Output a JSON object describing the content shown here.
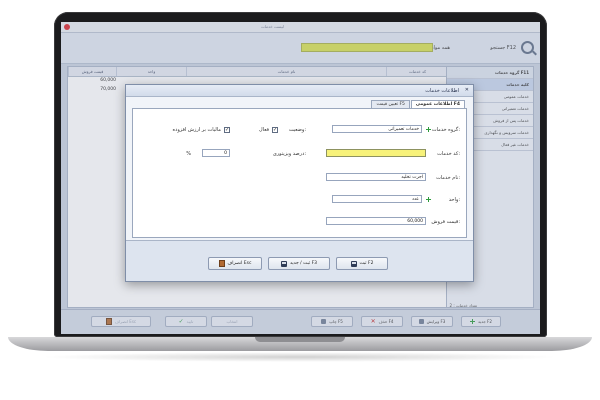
{
  "app": {
    "title": "لیست خدمات"
  },
  "toolbar": {
    "search_label": "جستجو F12",
    "field_label": "همه موارد"
  },
  "grid": {
    "columns": [
      "کد خدمات",
      "نام خدمات",
      "واحد",
      "قیمت فروش"
    ],
    "rows": [
      {
        "price": "60,000"
      },
      {
        "price": "70,000"
      }
    ],
    "footer": "تعداد خدمات : 2"
  },
  "categories": {
    "header": "گروه خدمات F11",
    "items": [
      "کلیه خدمات",
      "خدمات عمومی",
      "خدمات تعمیراتی",
      "خدمات پس از فروش",
      "خدمات سرویس و نگهداری",
      "خدمات غیر فعال"
    ]
  },
  "bottombar": {
    "new": "جدید F2",
    "edit": "ویرایش F3",
    "delete": "حذف F4",
    "print": "چاپ F5",
    "select": "انتخاب",
    "confirm": "تایید",
    "cancel": "انصراف Esc"
  },
  "dialog": {
    "title": "اطلاعات خدمات",
    "tabs": [
      "اطلاعات عمومی F4",
      "تعیین قیمت F5"
    ],
    "fields": {
      "group_label": "گروه خدمات:",
      "group_value": "خدمات تعمیراتی",
      "code_label": "کد خدمات:",
      "code_value": "",
      "name_label": "نام خدمات:",
      "name_value": "اجرت تخلیه",
      "unit_label": "واحد:",
      "unit_value": "عدد",
      "price_label": "قیمت فروش:",
      "price_value": "60,000",
      "status_label": "وضعیت:",
      "active_label": "فعال",
      "vat_label": "مالیات بر ارزش افزوده",
      "visitor_label": "درصد ویزیتوری:",
      "visitor_value": "0",
      "percent_sign": "%"
    },
    "buttons": {
      "save": "ثبت F2",
      "save_new": "ثبت / جدید F3",
      "cancel": "انصراف Esc"
    }
  },
  "colors": {
    "accent_yellow": "#f7f27a",
    "toolbar_yellow": "#d7e04f",
    "close_red": "#d8242b",
    "plus_green": "#2d9b3c"
  }
}
